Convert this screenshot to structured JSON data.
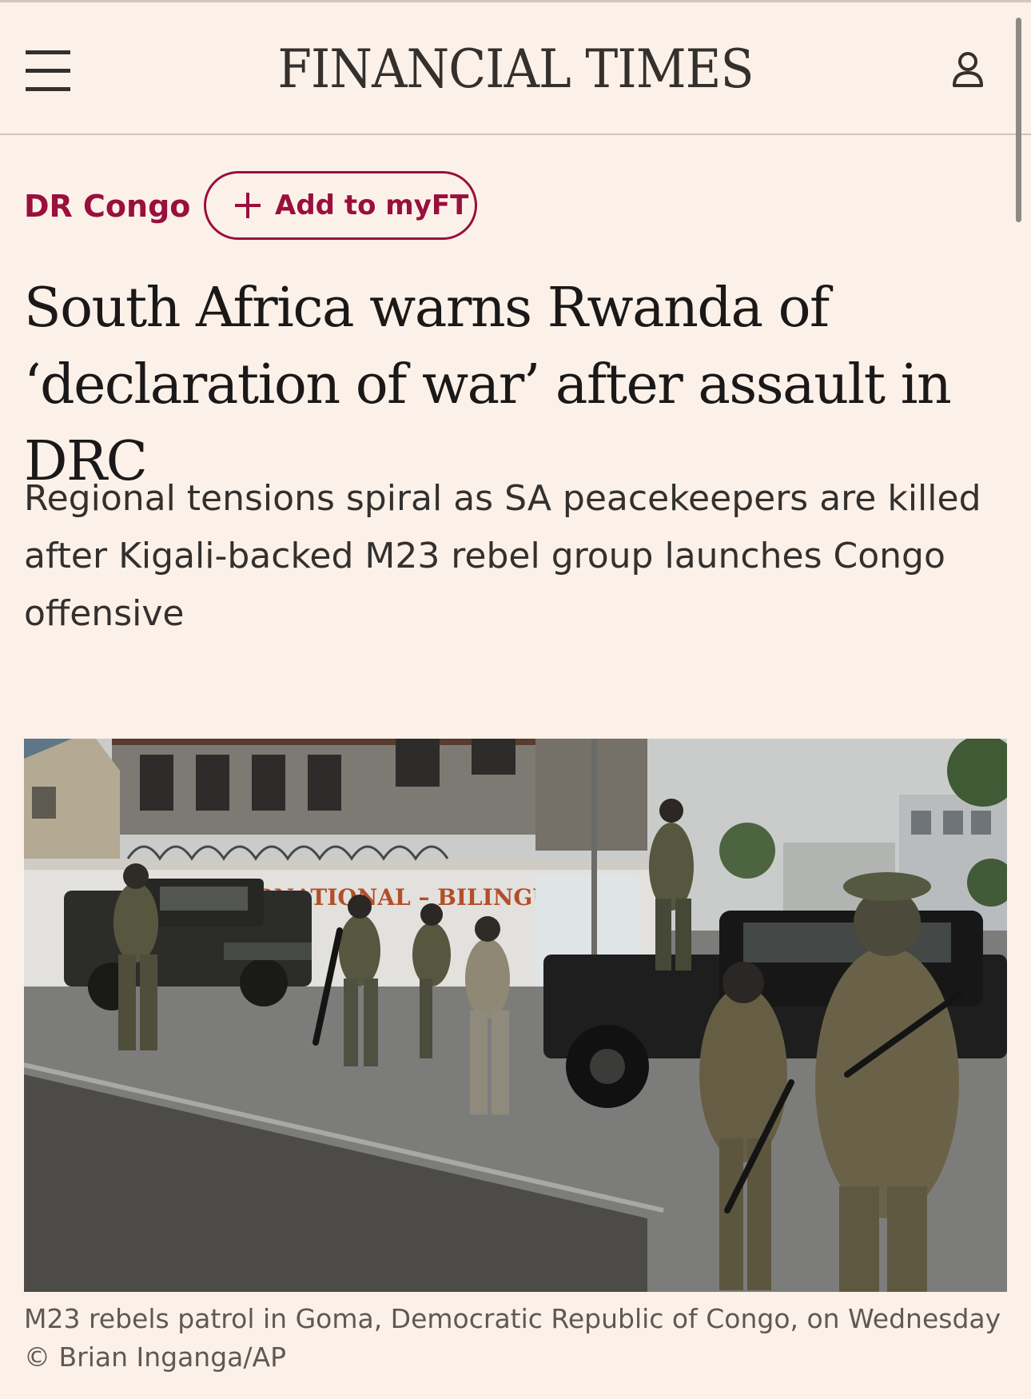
{
  "header": {
    "masthead": "FINANCIAL TIMES",
    "menu_icon": "hamburger-menu-icon",
    "account_icon": "user-account-icon"
  },
  "article": {
    "topic": "DR Congo",
    "myft_label": "Add to myFT",
    "myft_icon": "plus-icon",
    "headline": "South Africa warns Rwanda of ‘declaration of war’ after assault in DRC",
    "standfirst": "Regional tensions spiral as SA peacekeepers are killed after Kigali-backed M23 rebel group launches Congo offensive",
    "image": {
      "wall_text": "ERNATIONAL – BILINGUE",
      "caption": "M23 rebels patrol in Goma, Democratic Republic of Congo, on Wednesday © Brian Inganga/AP"
    }
  },
  "colors": {
    "background": "#fcf1e8",
    "accent": "#990f3d",
    "text": "#1a1818"
  }
}
